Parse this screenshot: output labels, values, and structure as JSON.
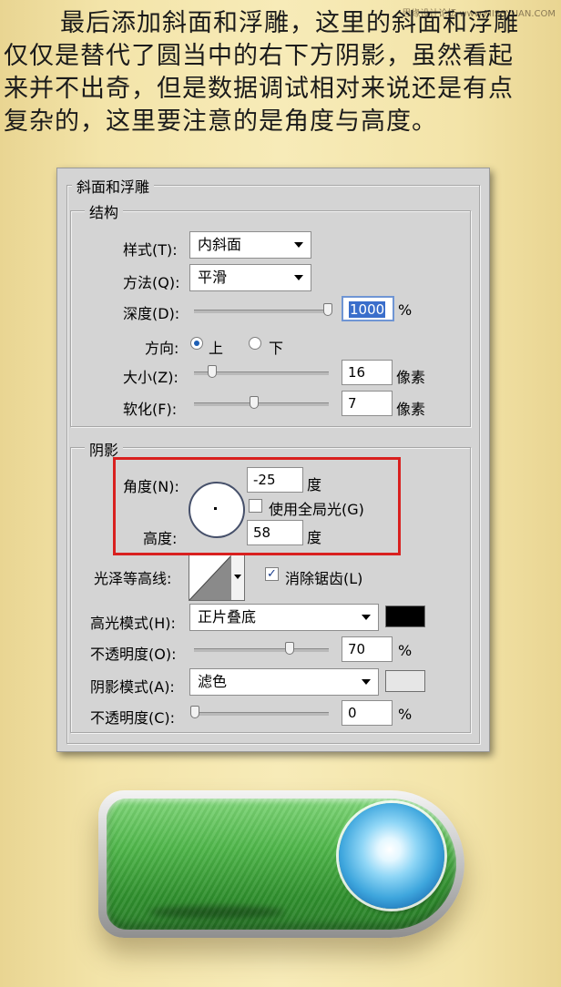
{
  "watermark": "思缘设计论坛 www.MISSYUAN.COM",
  "intro": {
    "line1": "最后添加斜面和浮雕，这里的斜面和浮雕",
    "line2": "仅仅是替代了圆当中的右下方阴影，虽然看起",
    "line3": "来并不出奇，但是数据调试相对来说还是有点",
    "line4": "复杂的，这里要注意的是角度与高度。"
  },
  "panel": {
    "title": "斜面和浮雕",
    "structure": {
      "title": "结构",
      "style_label": "样式(T):",
      "style_value": "内斜面",
      "technique_label": "方法(Q):",
      "technique_value": "平滑",
      "depth_label": "深度(D):",
      "depth_value": "1000",
      "depth_level": 1.0,
      "percent": "%",
      "direction_label": "方向:",
      "direction_up": "上",
      "direction_down": "下",
      "size_label": "大小(Z):",
      "size_value": "16",
      "soften_label": "软化(F):",
      "soften_value": "7",
      "pixels": "像素"
    },
    "shading": {
      "title": "阴影",
      "angle_label": "角度(N):",
      "angle_value": "-25",
      "degree": "度",
      "global_light_label": "使用全局光(G)",
      "global_light_checked": false,
      "altitude_label": "高度:",
      "altitude_value": "58",
      "gloss_contour_label": "光泽等高线:",
      "anti_aliased_label": "消除锯齿(L)",
      "anti_aliased_checked": true,
      "highlight_mode_label": "高光模式(H):",
      "highlight_mode_value": "正片叠底",
      "highlight_color": "#000000",
      "highlight_opacity_label": "不透明度(O):",
      "highlight_opacity_value": "70",
      "shadow_mode_label": "阴影模式(A):",
      "shadow_mode_value": "滤色",
      "shadow_color": "#e6e6e6",
      "shadow_opacity_label": "不透明度(C):",
      "shadow_opacity_value": "0",
      "percent": "%"
    }
  }
}
